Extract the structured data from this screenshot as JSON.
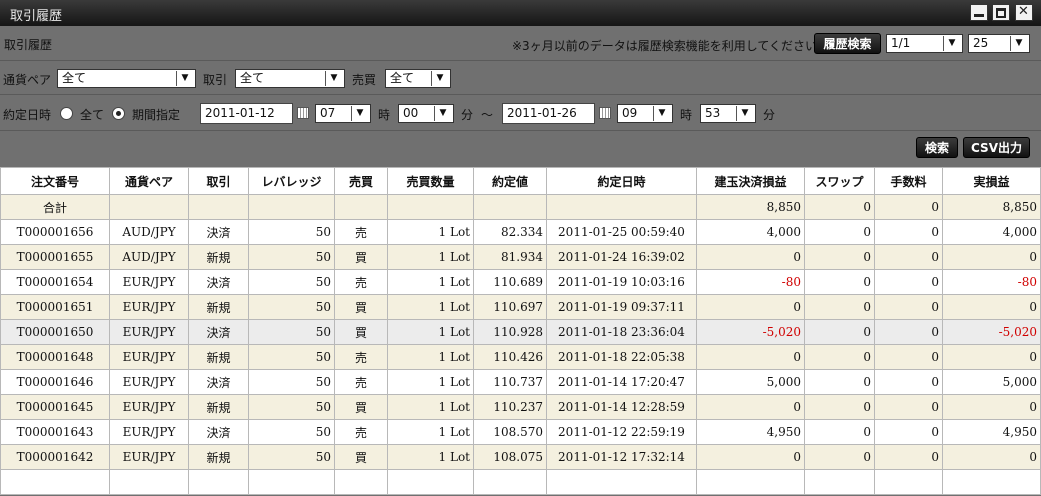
{
  "window": {
    "title": "取引履歴"
  },
  "toolbar": {
    "section_label": "取引履歴",
    "notice": "※3ヶ月以前のデータは履歴検索機能を利用してください。",
    "history_search_button": "履歴検索",
    "page_select": "1/1",
    "per_page_select": "25"
  },
  "filters": {
    "pair_label": "通貨ペア",
    "pair_value": "全て",
    "trade_label": "取引",
    "trade_value": "全て",
    "side_label": "売買",
    "side_value": "全て"
  },
  "date_filter": {
    "label": "約定日時",
    "all_label": "全て",
    "period_label": "期間指定",
    "from_date": "2011-01-12",
    "from_hour": "07",
    "from_min": "00",
    "to_date": "2011-01-26",
    "to_hour": "09",
    "to_min": "53",
    "hour_unit": "時",
    "min_unit": "分",
    "tilde": "～"
  },
  "actions": {
    "search_button": "検索",
    "csv_button": "CSV出力"
  },
  "table": {
    "headers": [
      "注文番号",
      "通貨ペア",
      "取引",
      "レバレッジ",
      "売買",
      "売買数量",
      "約定値",
      "約定日時",
      "建玉決済損益",
      "スワップ",
      "手数料",
      "実損益"
    ],
    "total": {
      "label": "合計",
      "pnl": "8,850",
      "swap": "0",
      "fee": "0",
      "real": "8,850"
    },
    "rows": [
      [
        "T000001656",
        "AUD/JPY",
        "決済",
        "50",
        "売",
        "1 Lot",
        "82.334",
        "2011-01-25 00:59:40",
        "4,000",
        "0",
        "0",
        "4,000"
      ],
      [
        "T000001655",
        "AUD/JPY",
        "新規",
        "50",
        "買",
        "1 Lot",
        "81.934",
        "2011-01-24 16:39:02",
        "0",
        "0",
        "0",
        "0"
      ],
      [
        "T000001654",
        "EUR/JPY",
        "決済",
        "50",
        "売",
        "1 Lot",
        "110.689",
        "2011-01-19 10:03:16",
        "-80",
        "0",
        "0",
        "-80"
      ],
      [
        "T000001651",
        "EUR/JPY",
        "新規",
        "50",
        "買",
        "1 Lot",
        "110.697",
        "2011-01-19 09:37:11",
        "0",
        "0",
        "0",
        "0"
      ],
      [
        "T000001650",
        "EUR/JPY",
        "決済",
        "50",
        "買",
        "1 Lot",
        "110.928",
        "2011-01-18 23:36:04",
        "-5,020",
        "0",
        "0",
        "-5,020"
      ],
      [
        "T000001648",
        "EUR/JPY",
        "新規",
        "50",
        "売",
        "1 Lot",
        "110.426",
        "2011-01-18 22:05:38",
        "0",
        "0",
        "0",
        "0"
      ],
      [
        "T000001646",
        "EUR/JPY",
        "決済",
        "50",
        "売",
        "1 Lot",
        "110.737",
        "2011-01-14 17:20:47",
        "5,000",
        "0",
        "0",
        "5,000"
      ],
      [
        "T000001645",
        "EUR/JPY",
        "新規",
        "50",
        "買",
        "1 Lot",
        "110.237",
        "2011-01-14 12:28:59",
        "0",
        "0",
        "0",
        "0"
      ],
      [
        "T000001643",
        "EUR/JPY",
        "決済",
        "50",
        "売",
        "1 Lot",
        "108.570",
        "2011-01-12 22:59:19",
        "4,950",
        "0",
        "0",
        "4,950"
      ],
      [
        "T000001642",
        "EUR/JPY",
        "新規",
        "50",
        "買",
        "1 Lot",
        "108.075",
        "2011-01-12 17:32:14",
        "0",
        "0",
        "0",
        "0"
      ]
    ],
    "highlighted_row": 4
  },
  "colors": {
    "negative": "#d00000",
    "alt_row": "#f4f0df",
    "panel": "#707070"
  }
}
